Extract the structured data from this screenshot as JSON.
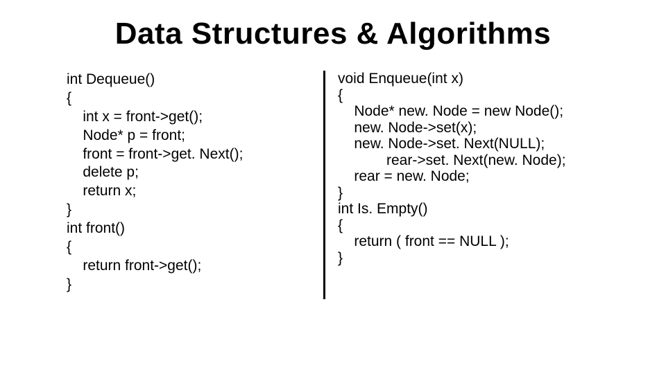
{
  "title": "Data Structures & Algorithms",
  "left_code": "int Dequeue()\n{\n    int x = front->get();\n    Node* p = front;\n    front = front->get. Next();\n    delete p;\n    return x;\n}\nint front()\n{\n    return front->get();\n}",
  "right_code": "void Enqueue(int x)\n{\n    Node* new. Node = new Node();\n    new. Node->set(x);\n    new. Node->set. Next(NULL);\n            rear->set. Next(new. Node);\n    rear = new. Node;\n}\nint Is. Empty()\n{\n    return ( front == NULL );\n}"
}
